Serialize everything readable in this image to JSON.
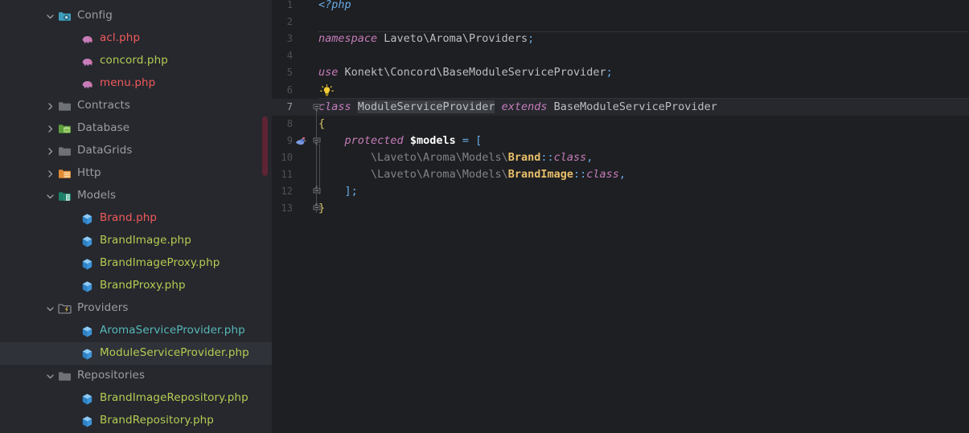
{
  "sidebar": {
    "name": "project-file-tree",
    "scrollbar_color": "#5e2433",
    "items": [
      {
        "label": "Config",
        "type": "folder",
        "icon": "folder-config-icon",
        "indent": 1,
        "expanded": true,
        "color": "#9b9da1",
        "icon_color": "#3592c4",
        "selected": false
      },
      {
        "label": "acl.php",
        "type": "file",
        "icon": "php-elephant-icon",
        "indent": 2,
        "expanded": null,
        "color": "#f05a5b",
        "icon_color": "#c77dbb",
        "selected": false
      },
      {
        "label": "concord.php",
        "type": "file",
        "icon": "php-elephant-icon",
        "indent": 2,
        "expanded": null,
        "color": "#b5cc52",
        "icon_color": "#c77dbb",
        "selected": false
      },
      {
        "label": "menu.php",
        "type": "file",
        "icon": "php-elephant-icon",
        "indent": 2,
        "expanded": null,
        "color": "#f05a5b",
        "icon_color": "#c77dbb",
        "selected": false
      },
      {
        "label": "Contracts",
        "type": "folder",
        "icon": "folder-icon",
        "indent": 1,
        "expanded": false,
        "color": "#9b9da1",
        "icon_color": "#6e7175",
        "selected": false
      },
      {
        "label": "Database",
        "type": "folder",
        "icon": "folder-database-icon",
        "indent": 1,
        "expanded": false,
        "color": "#9b9da1",
        "icon_color": "#62a03f",
        "selected": false
      },
      {
        "label": "DataGrids",
        "type": "folder",
        "icon": "folder-icon",
        "indent": 1,
        "expanded": false,
        "color": "#9b9da1",
        "icon_color": "#6e7175",
        "selected": false
      },
      {
        "label": "Http",
        "type": "folder",
        "icon": "folder-http-icon",
        "indent": 1,
        "expanded": false,
        "color": "#9b9da1",
        "icon_color": "#e08c34",
        "selected": false
      },
      {
        "label": "Models",
        "type": "folder",
        "icon": "folder-models-icon",
        "indent": 1,
        "expanded": true,
        "color": "#9b9da1",
        "icon_color": "#229073",
        "selected": false
      },
      {
        "label": "Brand.php",
        "type": "file",
        "icon": "php-class-icon",
        "indent": 2,
        "expanded": null,
        "color": "#f05a5b",
        "icon_color": "#3592c4",
        "selected": false
      },
      {
        "label": "BrandImage.php",
        "type": "file",
        "icon": "php-class-icon",
        "indent": 2,
        "expanded": null,
        "color": "#b5cc52",
        "icon_color": "#3592c4",
        "selected": false
      },
      {
        "label": "BrandImageProxy.php",
        "type": "file",
        "icon": "php-class-icon",
        "indent": 2,
        "expanded": null,
        "color": "#b5cc52",
        "icon_color": "#3592c4",
        "selected": false
      },
      {
        "label": "BrandProxy.php",
        "type": "file",
        "icon": "php-class-icon",
        "indent": 2,
        "expanded": null,
        "color": "#b5cc52",
        "icon_color": "#3592c4",
        "selected": false
      },
      {
        "label": "Providers",
        "type": "folder",
        "icon": "folder-providers-icon",
        "indent": 1,
        "expanded": true,
        "color": "#9b9da1",
        "icon_color": "#6e7175",
        "selected": false
      },
      {
        "label": "AromaServiceProvider.php",
        "type": "file",
        "icon": "php-class-icon",
        "indent": 2,
        "expanded": null,
        "color": "#57b9b8",
        "icon_color": "#3592c4",
        "selected": false
      },
      {
        "label": "ModuleServiceProvider.php",
        "type": "file",
        "icon": "php-class-icon",
        "indent": 2,
        "expanded": null,
        "color": "#b5cc52",
        "icon_color": "#3592c4",
        "selected": true
      },
      {
        "label": "Repositories",
        "type": "folder",
        "icon": "folder-icon",
        "indent": 1,
        "expanded": true,
        "color": "#9b9da1",
        "icon_color": "#6e7175",
        "selected": false
      },
      {
        "label": "BrandImageRepository.php",
        "type": "file",
        "icon": "php-class-icon",
        "indent": 2,
        "expanded": null,
        "color": "#b5cc52",
        "icon_color": "#3592c4",
        "selected": false
      },
      {
        "label": "BrandRepository.php",
        "type": "file",
        "icon": "php-class-icon",
        "indent": 2,
        "expanded": null,
        "color": "#b5cc52",
        "icon_color": "#3592c4",
        "selected": false
      }
    ]
  },
  "editor": {
    "name": "code-editor",
    "file": "ModuleServiceProvider.php",
    "language": "php",
    "current_line": 7,
    "gutter_icons": [
      {
        "line": 6,
        "icon": "lightbulb-intention-icon",
        "color": "#f5d033"
      },
      {
        "line": 9,
        "icon": "laravel-gutter-icon",
        "color": "#6a8cd6"
      }
    ],
    "lines": [
      {
        "n": 1,
        "text": "<?php"
      },
      {
        "n": 2,
        "text": ""
      },
      {
        "n": 3,
        "text": "namespace Laveto\\Aroma\\Providers;"
      },
      {
        "n": 4,
        "text": ""
      },
      {
        "n": 5,
        "text": "use Konekt\\Concord\\BaseModuleServiceProvider;"
      },
      {
        "n": 6,
        "text": ""
      },
      {
        "n": 7,
        "text": "class ModuleServiceProvider extends BaseModuleServiceProvider"
      },
      {
        "n": 8,
        "text": "{"
      },
      {
        "n": 9,
        "text": "    protected $models = ["
      },
      {
        "n": 10,
        "text": "        \\Laveto\\Aroma\\Models\\Brand::class,"
      },
      {
        "n": 11,
        "text": "        \\Laveto\\Aroma\\Models\\BrandImage::class,"
      },
      {
        "n": 12,
        "text": "    ];"
      },
      {
        "n": 13,
        "text": "}"
      }
    ],
    "highlighted_identifier": "ModuleServiceProvider",
    "fold_markers": [
      7,
      9,
      12,
      13
    ]
  }
}
